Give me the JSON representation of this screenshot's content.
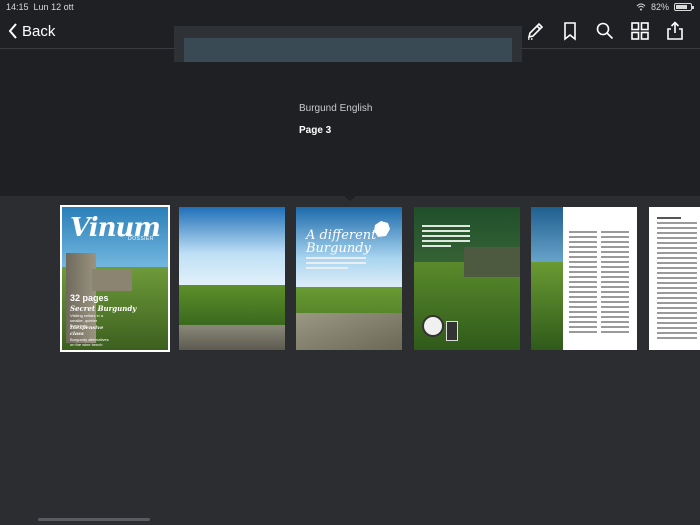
{
  "status": {
    "time": "14:15",
    "date": "Lun 12 ott",
    "battery": "82%",
    "battery_level": 0.82
  },
  "nav": {
    "back_label": "Back",
    "toolbar_icons": [
      "pencil-icon",
      "bookmark-icon",
      "search-icon",
      "grid-icon",
      "share-icon"
    ]
  },
  "document": {
    "title": "Burgund English",
    "page_label": "Page 3"
  },
  "thumbnails": {
    "cover": {
      "title": "Vinum",
      "subtitle": "DOSSIER",
      "headline_count": "32 pages",
      "headline": "Secret Burgundy",
      "blurb": "Visiting cellars in a smaller, quieter Burgundy",
      "feature": "Inexpensive class",
      "feature_blurb": "Burgundy alternatives on the wine bench"
    },
    "spread_title": "A different Burgundy",
    "selected_index": 0
  },
  "colors": {
    "background": "#2b2d31",
    "top_background": "#1f2024",
    "accent": "#ffffff"
  }
}
